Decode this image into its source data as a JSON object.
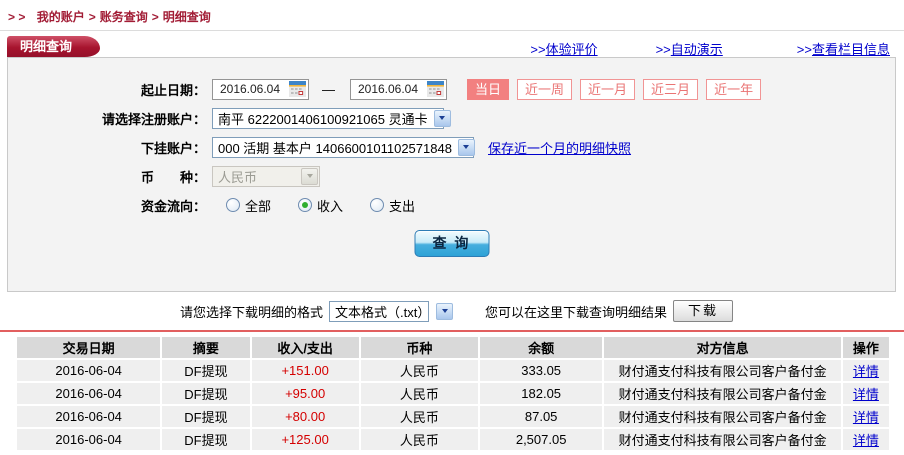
{
  "breadcrumb": {
    "prefix": "> >",
    "items": [
      {
        "sep": "",
        "label": "我的账户"
      },
      {
        "sep": ">",
        "label": "账务查询"
      },
      {
        "sep": ">",
        "label": "明细查询"
      }
    ]
  },
  "tab": {
    "label": "明细查询"
  },
  "top_links": [
    {
      "prefix": ">>",
      "label": "体验评价"
    },
    {
      "prefix": ">>",
      "label": "自动演示"
    },
    {
      "prefix": ">>",
      "label": "查看栏目信息"
    }
  ],
  "form": {
    "date_label": "起止日期：",
    "date_from": "2016.06.04",
    "date_separator": "—",
    "date_to": "2016.06.04",
    "range_buttons": [
      {
        "label": "当日",
        "active": true
      },
      {
        "label": "近一周"
      },
      {
        "label": "近一月"
      },
      {
        "label": "近三月"
      },
      {
        "label": "近一年"
      }
    ],
    "register_label": "请选择注册账户：",
    "register_value": "南平  6222001406100921065  灵通卡",
    "sub_label": "下挂账户：",
    "sub_value": "000 活期 基本户 1406600101102571848",
    "snapshot_link": "保存近一个月的明细快照",
    "currency_label": "币　　种：",
    "currency_value": "人民币",
    "flow_label": "资金流向：",
    "flow_options": [
      {
        "label": "全部"
      },
      {
        "label": "收入",
        "checked": true
      },
      {
        "label": "支出"
      }
    ],
    "query_button": "查 询"
  },
  "download": {
    "format_label": "请您选择下载明细的格式",
    "format_value": "文本格式（.txt）",
    "hint": "您可以在这里下载查询明细结果",
    "button": "下载"
  },
  "table": {
    "headers": [
      {
        "label": "交易日期"
      },
      {
        "label": "摘要"
      },
      {
        "label": "收入/支出"
      },
      {
        "label": "币种"
      },
      {
        "label": "余额"
      },
      {
        "label": "对方信息"
      },
      {
        "label": "操作"
      }
    ],
    "rows": [
      {
        "date": "2016-06-04",
        "summary": "DF提现",
        "amount": "+151.00",
        "currency": "人民币",
        "balance": "333.05",
        "counterparty": "财付通支付科技有限公司客户备付金",
        "action": "详情"
      },
      {
        "date": "2016-06-04",
        "summary": "DF提现",
        "amount": "+95.00",
        "currency": "人民币",
        "balance": "182.05",
        "counterparty": "财付通支付科技有限公司客户备付金",
        "action": "详情"
      },
      {
        "date": "2016-06-04",
        "summary": "DF提现",
        "amount": "+80.00",
        "currency": "人民币",
        "balance": "87.05",
        "counterparty": "财付通支付科技有限公司客户备付金",
        "action": "详情"
      },
      {
        "date": "2016-06-04",
        "summary": "DF提现",
        "amount": "+125.00",
        "currency": "人民币",
        "balance": "2,507.05",
        "counterparty": "财付通支付科技有限公司客户备付金",
        "action": "详情"
      }
    ]
  },
  "colors": {
    "brand_red": "#a21c35",
    "salmon": "#f28080",
    "link_blue": "#0000cc",
    "amount_red": "#d40000",
    "query_button_blue": "#2ea2d6",
    "table_header_bg": "#d9d9d9",
    "table_row_bg": "#efefef",
    "panel_bg": "#f3f3f3"
  }
}
